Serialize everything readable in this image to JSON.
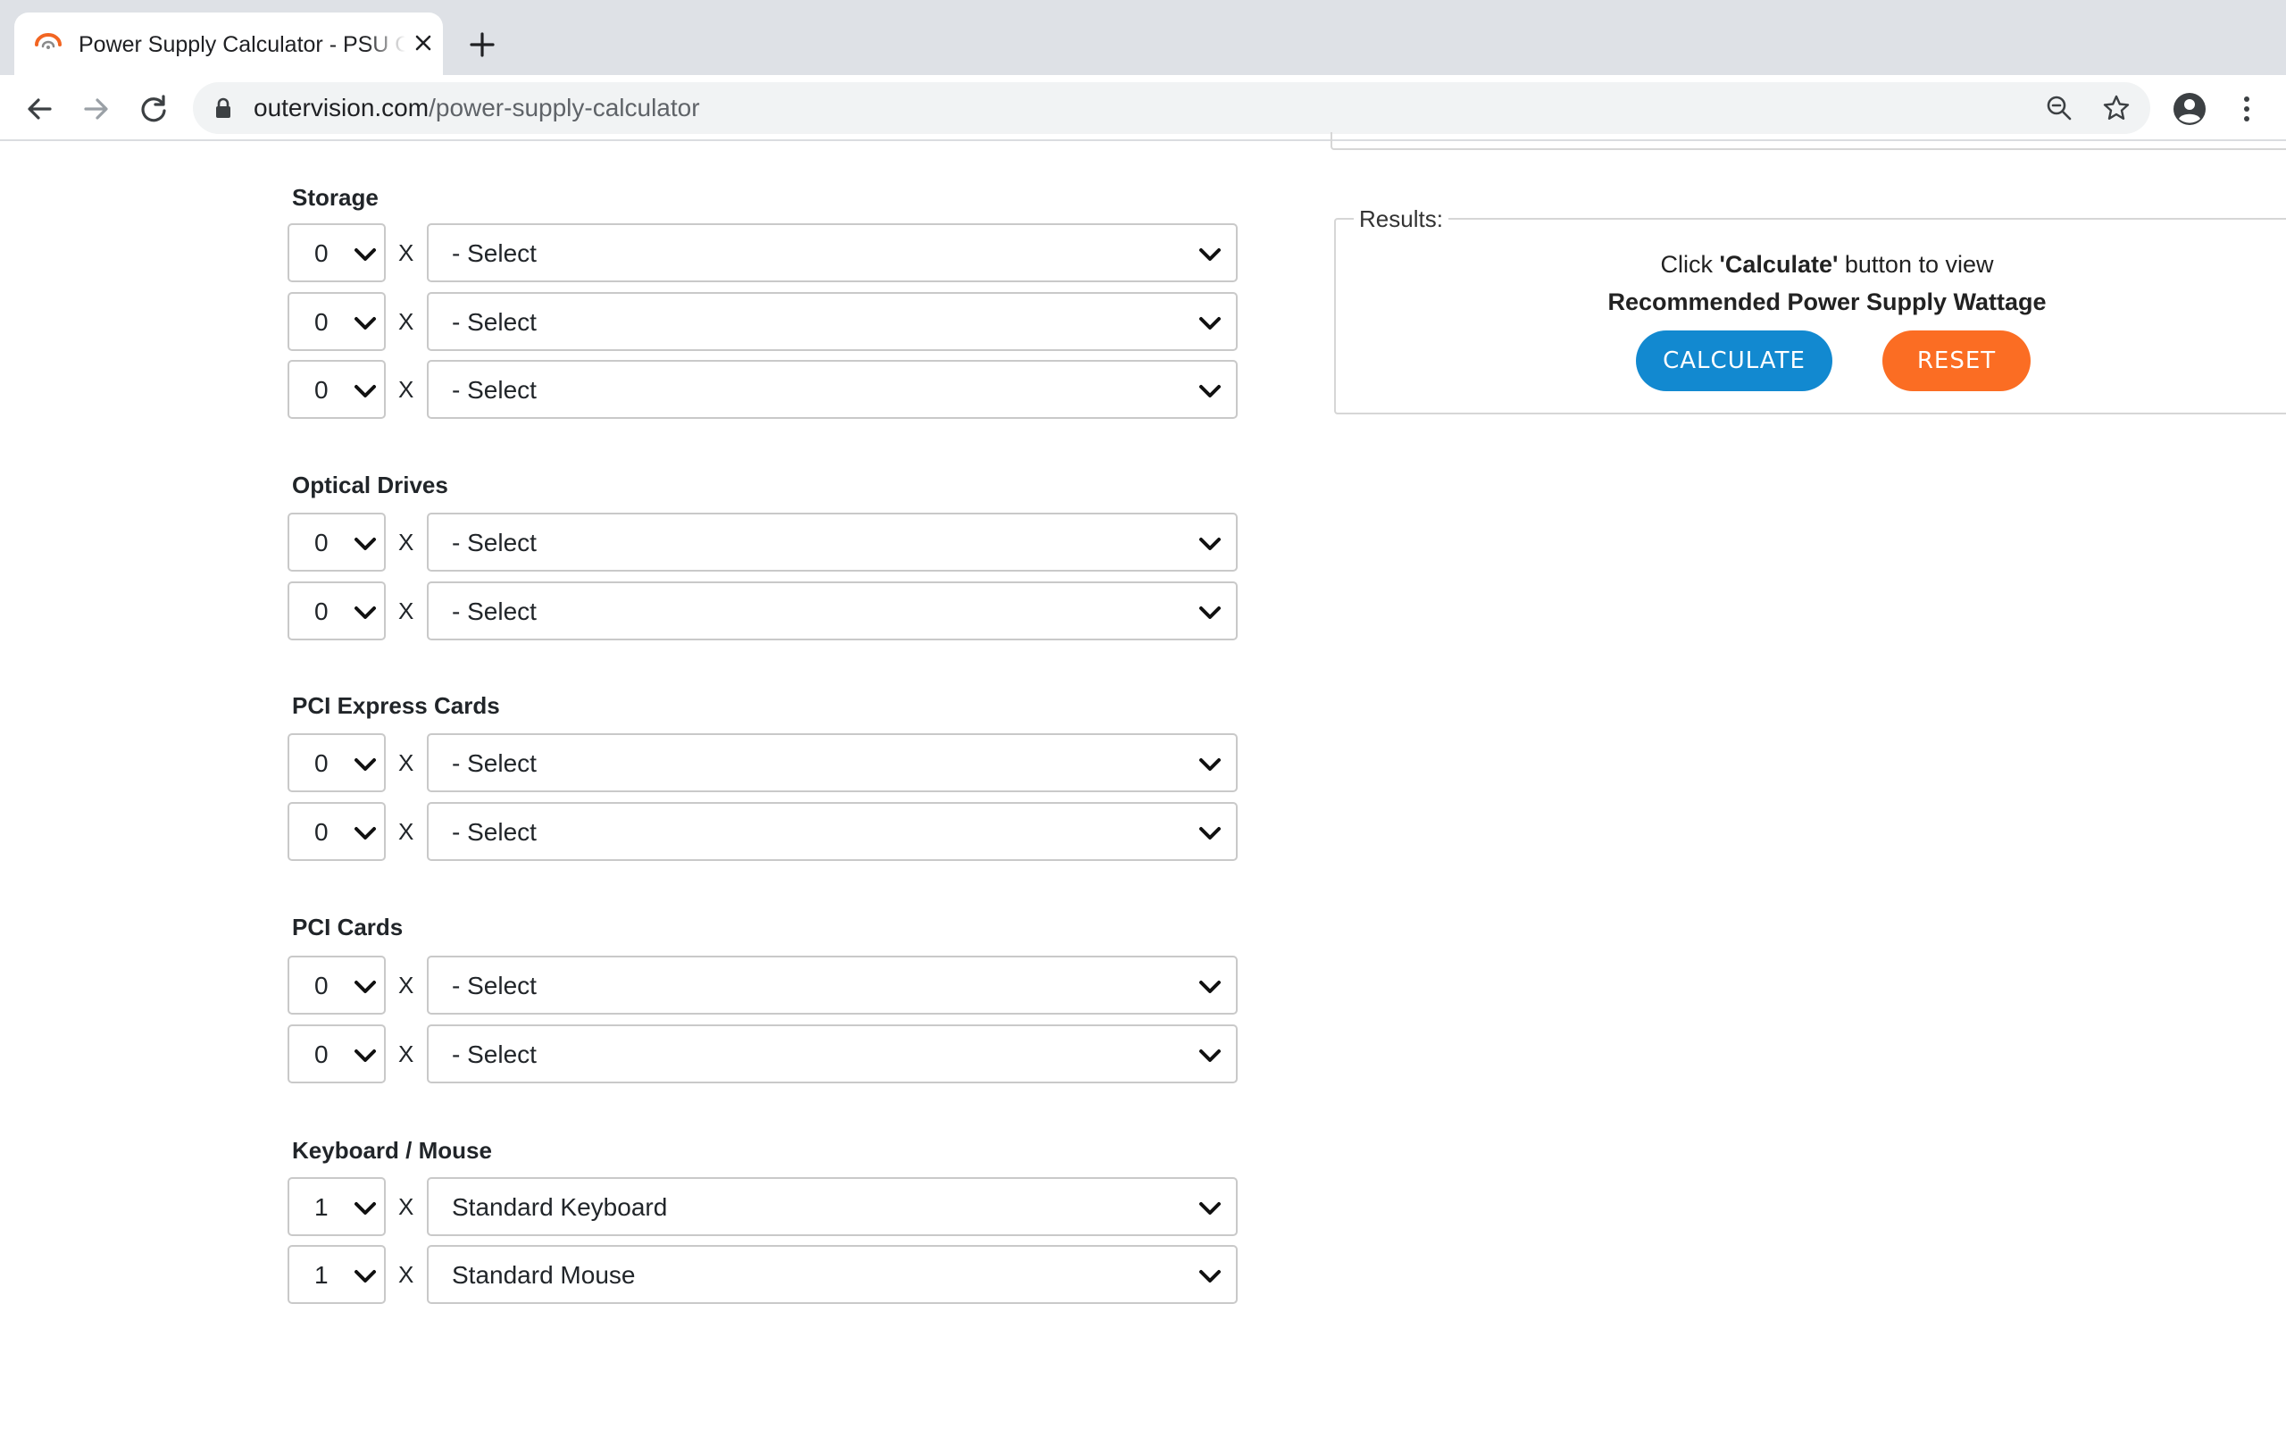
{
  "browser": {
    "tab_title": "Power Supply Calculator - PSU Calculator | OuterVision",
    "url_host": "outervision.com",
    "url_path": "/power-supply-calculator"
  },
  "sections": [
    {
      "label": "Storage",
      "rows": [
        {
          "qty": "0",
          "select": "- Select"
        },
        {
          "qty": "0",
          "select": "- Select"
        },
        {
          "qty": "0",
          "select": "- Select"
        }
      ]
    },
    {
      "label": "Optical Drives",
      "rows": [
        {
          "qty": "0",
          "select": "- Select"
        },
        {
          "qty": "0",
          "select": "- Select"
        }
      ]
    },
    {
      "label": "PCI Express Cards",
      "rows": [
        {
          "qty": "0",
          "select": "- Select"
        },
        {
          "qty": "0",
          "select": "- Select"
        }
      ]
    },
    {
      "label": "PCI Cards",
      "rows": [
        {
          "qty": "0",
          "select": "- Select"
        },
        {
          "qty": "0",
          "select": "- Select"
        }
      ]
    },
    {
      "label": "Keyboard / Mouse",
      "rows": [
        {
          "qty": "1",
          "select": "Standard Keyboard"
        },
        {
          "qty": "1",
          "select": "Standard Mouse"
        }
      ]
    }
  ],
  "multiply_sign": "X",
  "results": {
    "legend": "Results:",
    "line1_prefix": "Click ",
    "line1_bold": "'Calculate'",
    "line1_suffix": " button to view",
    "line2": "Recommended Power Supply Wattage",
    "calculate_label": "CALCULATE",
    "reset_label": "RESET"
  },
  "colors": {
    "calculate": "#1289d0",
    "reset": "#fb6d23",
    "favicon": "#f26522"
  },
  "icons": [
    "favicon-icon",
    "close-icon",
    "plus-icon",
    "back-arrow-icon",
    "forward-arrow-icon",
    "reload-icon",
    "lock-icon",
    "zoom-icon",
    "star-icon",
    "account-icon",
    "more-vert-icon",
    "chevron-down-icon"
  ]
}
